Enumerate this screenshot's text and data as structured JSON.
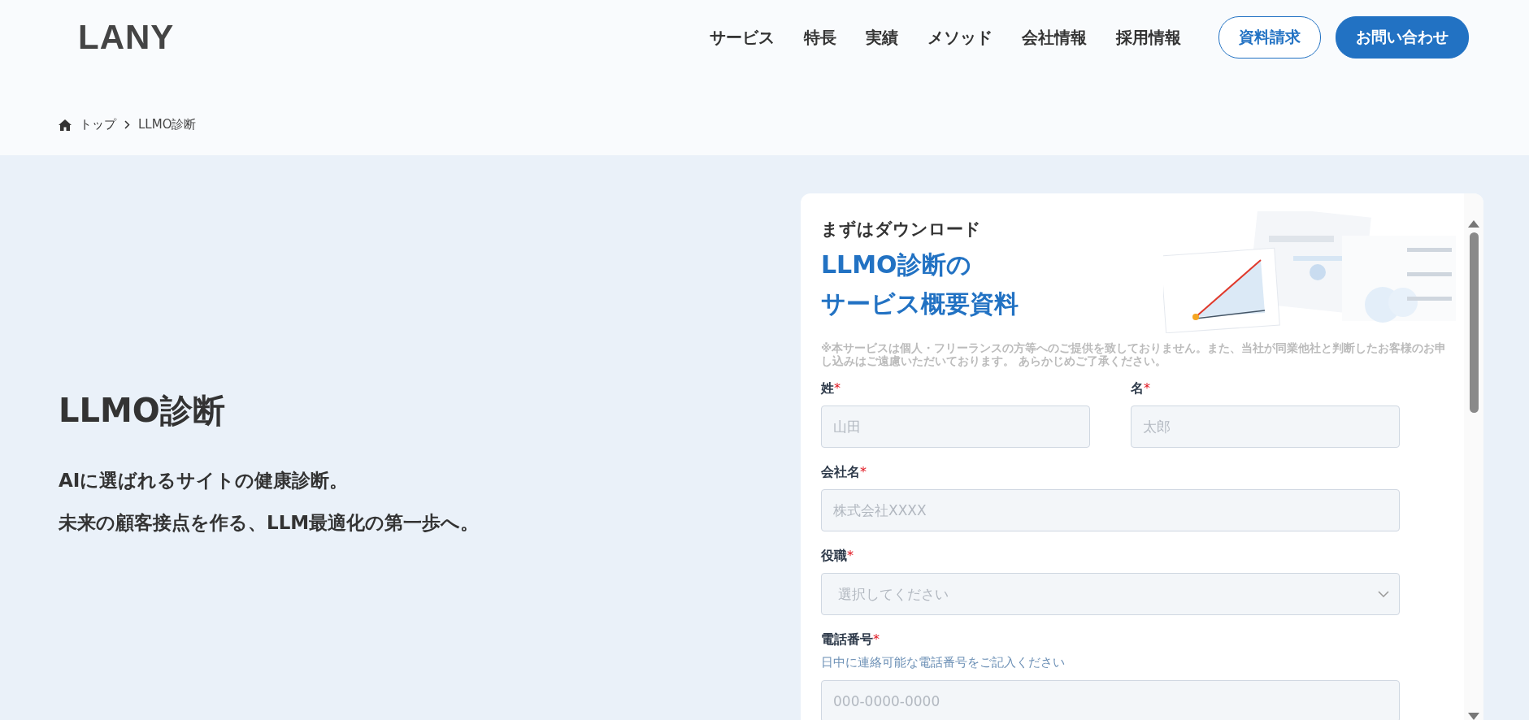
{
  "header": {
    "logo": "LANY",
    "nav": [
      "サービス",
      "特長",
      "実績",
      "メソッド",
      "会社情報",
      "採用情報"
    ],
    "buttons": [
      {
        "label": "資料請求",
        "kind": "outline"
      },
      {
        "label": "お問い合わせ",
        "kind": "filled"
      }
    ]
  },
  "breadcrumb": [
    "トップ",
    "LLMO診断"
  ],
  "hero": {
    "title": "LLMO診断",
    "lines": [
      "AIに選ばれるサイトの健康診断。",
      "未来の顧客接点を作る、LLM最適化の第一歩へ。"
    ]
  },
  "form": {
    "eyebrow": "まずはダウンロード",
    "title_lines": [
      "LLMO診断の",
      "サービス概要資料"
    ],
    "preview": {
      "kind": "picture"
    },
    "note": "※本サービスは個人・フリーランスの方等へのご提供を致しておりません。また、当社が同業他社と判断したお客様のお申し込みはご遠慮いただいております。 あらかじめご了承ください。",
    "name_fields": [
      {
        "label": "姓",
        "required_mark": "*",
        "placeholder": "山田"
      },
      {
        "label": "名",
        "required_mark": "*",
        "placeholder": "太郎"
      }
    ],
    "fields": [
      {
        "kind": "input",
        "label": "会社名",
        "required_mark": "*",
        "placeholder": "株式会社XXXX"
      },
      {
        "kind": "select",
        "label": "役職",
        "required_mark": "*",
        "placeholder": "選択してください"
      },
      {
        "kind": "input",
        "label": "電話番号",
        "required_mark": "*",
        "hint": "日中に連絡可能な電話番号をご記入ください",
        "placeholder": "000-0000-0000"
      }
    ]
  }
}
